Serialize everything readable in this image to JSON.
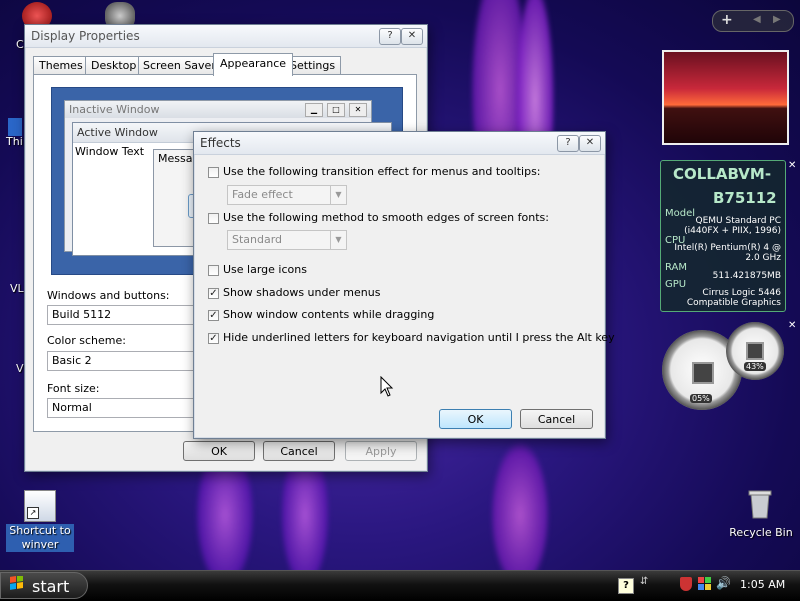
{
  "desktop": {
    "icons": [
      {
        "label": "Shortcut to winver"
      },
      {
        "label": "Recycle Bin"
      }
    ],
    "partial_labels": [
      "C",
      "Thi",
      "VL",
      "V"
    ]
  },
  "display_properties": {
    "title": "Display Properties",
    "help_btn": "?",
    "close_btn": "✕",
    "tabs": [
      "Themes",
      "Desktop",
      "Screen Saver",
      "Appearance",
      "Settings"
    ],
    "preview": {
      "inactive_title": "Inactive Window",
      "active_title": "Active Window",
      "window_text": "Window Text",
      "message_title": "Messag"
    },
    "windows_buttons_label": "Windows and buttons:",
    "windows_buttons_value": "Build 5112",
    "color_scheme_label": "Color scheme:",
    "color_scheme_value": "Basic 2",
    "font_size_label": "Font size:",
    "font_size_value": "Normal",
    "ok": "OK",
    "cancel": "Cancel",
    "apply": "Apply"
  },
  "effects": {
    "title": "Effects",
    "help_btn": "?",
    "close_btn": "✕",
    "options": [
      {
        "label": "Use the following transition effect for menus and tooltips:",
        "checked": false
      },
      {
        "label": "Use the following method to smooth edges of screen fonts:",
        "checked": false
      },
      {
        "label": "Use large icons",
        "checked": false
      },
      {
        "label": "Show shadows under menus",
        "checked": true
      },
      {
        "label": "Show window contents while dragging",
        "checked": true
      },
      {
        "label": "Hide underlined letters for keyboard navigation until I press the Alt key",
        "checked": true
      }
    ],
    "transition_value": "Fade effect",
    "smooth_value": "Standard",
    "ok": "OK",
    "cancel": "Cancel"
  },
  "sidebar_gadget": {
    "hostname_line1": "COLLABVM-",
    "hostname_line2": "B75112",
    "model_label": "Model",
    "model_value1": "QEMU Standard PC",
    "model_value2": "(i440FX + PIIX, 1996)",
    "cpu_label": "CPU",
    "cpu_value1": "Intel(R) Pentium(R) 4 @",
    "cpu_value2": "2.0 GHz",
    "ram_label": "RAM",
    "ram_value": "511.421875MB",
    "gpu_label": "GPU",
    "gpu_value1": "Cirrus Logic 5446",
    "gpu_value2": "Compatible Graphics",
    "cpu_meter": "05%",
    "mem_meter": "43%"
  },
  "taskbar": {
    "start_label": "start",
    "clock": "1:05 AM"
  },
  "colors": {
    "taskbar": "#1b1b1b",
    "gadget_title": "#b7e8c9",
    "accent_blue": "#3c7fb1"
  }
}
